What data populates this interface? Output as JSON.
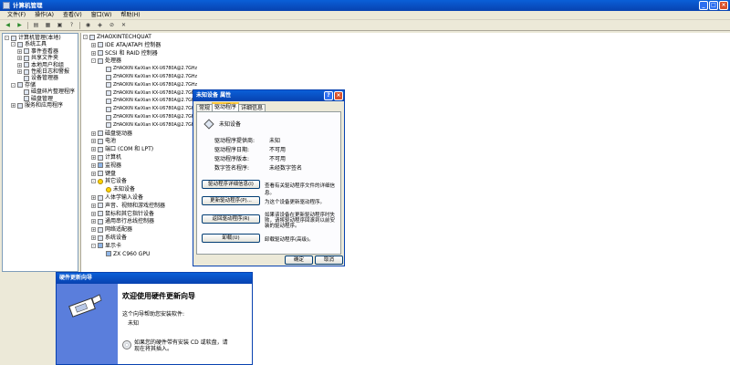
{
  "window": {
    "title": "计算机管理",
    "buttons": [
      "_",
      "□",
      "×"
    ]
  },
  "menu": [
    "文件(F)",
    "操作(A)",
    "查看(V)",
    "窗口(W)",
    "帮助(H)"
  ],
  "left_tree": [
    {
      "label": "计算机管理(本地)",
      "indent": 0,
      "exp": "-"
    },
    {
      "label": "系统工具",
      "indent": 1,
      "exp": "-"
    },
    {
      "label": "事件查看器",
      "indent": 2,
      "exp": "+"
    },
    {
      "label": "共享文件夹",
      "indent": 2,
      "exp": "+"
    },
    {
      "label": "本地用户和组",
      "indent": 2,
      "exp": "+"
    },
    {
      "label": "性能日志和警报",
      "indent": 2,
      "exp": "+"
    },
    {
      "label": "设备管理器",
      "indent": 2,
      "exp": ""
    },
    {
      "label": "存储",
      "indent": 1,
      "exp": "-"
    },
    {
      "label": "磁盘碎片整理程序",
      "indent": 2,
      "exp": ""
    },
    {
      "label": "磁盘管理",
      "indent": 2,
      "exp": ""
    },
    {
      "label": "服务和应用程序",
      "indent": 1,
      "exp": "+"
    }
  ],
  "device_tree": [
    {
      "label": "ZHAOXINTECHQUAT",
      "indent": 0,
      "exp": "-",
      "icon": "computer"
    },
    {
      "label": "IDE ATA/ATAPI 控制器",
      "indent": 1,
      "exp": "+",
      "icon": "device"
    },
    {
      "label": "SCSI 和 RAID 控制器",
      "indent": 1,
      "exp": "+",
      "icon": "device"
    },
    {
      "label": "处理器",
      "indent": 1,
      "exp": "-",
      "icon": "device"
    },
    {
      "label": "ZHAOXIN KaiXian KX-U6780A@2.7GHz",
      "indent": 2,
      "exp": "",
      "icon": "cpu"
    },
    {
      "label": "ZHAOXIN KaiXian KX-U6780A@2.7GHz",
      "indent": 2,
      "exp": "",
      "icon": "cpu"
    },
    {
      "label": "ZHAOXIN KaiXian KX-U6780A@2.7GHz",
      "indent": 2,
      "exp": "",
      "icon": "cpu"
    },
    {
      "label": "ZHAOXIN KaiXian KX-U6780A@2.7GHz",
      "indent": 2,
      "exp": "",
      "icon": "cpu"
    },
    {
      "label": "ZHAOXIN KaiXian KX-U6780A@2.7GHz",
      "indent": 2,
      "exp": "",
      "icon": "cpu"
    },
    {
      "label": "ZHAOXIN KaiXian KX-U6780A@2.7GHz",
      "indent": 2,
      "exp": "",
      "icon": "cpu"
    },
    {
      "label": "ZHAOXIN KaiXian KX-U6780A@2.7GHz",
      "indent": 2,
      "exp": "",
      "icon": "cpu"
    },
    {
      "label": "ZHAOXIN KaiXian KX-U6780A@2.7GHz",
      "indent": 2,
      "exp": "",
      "icon": "cpu"
    },
    {
      "label": "磁盘驱动器",
      "indent": 1,
      "exp": "+",
      "icon": "device"
    },
    {
      "label": "电池",
      "indent": 1,
      "exp": "+",
      "icon": "device"
    },
    {
      "label": "端口 (COM 和 LPT)",
      "indent": 1,
      "exp": "+",
      "icon": "device"
    },
    {
      "label": "计算机",
      "indent": 1,
      "exp": "+",
      "icon": "device"
    },
    {
      "label": "监视器",
      "indent": 1,
      "exp": "+",
      "icon": "monitor"
    },
    {
      "label": "键盘",
      "indent": 1,
      "exp": "+",
      "icon": "device"
    },
    {
      "label": "其它设备",
      "indent": 1,
      "exp": "-",
      "icon": "warn"
    },
    {
      "label": "未知设备",
      "indent": 2,
      "exp": "",
      "icon": "warn"
    },
    {
      "label": "人体学输入设备",
      "indent": 1,
      "exp": "+",
      "icon": "device"
    },
    {
      "label": "声音、视频和游戏控制器",
      "indent": 1,
      "exp": "+",
      "icon": "device"
    },
    {
      "label": "鼠标和其它指针设备",
      "indent": 1,
      "exp": "+",
      "icon": "device"
    },
    {
      "label": "通用串行总线控制器",
      "indent": 1,
      "exp": "+",
      "icon": "device"
    },
    {
      "label": "网络适配器",
      "indent": 1,
      "exp": "+",
      "icon": "device"
    },
    {
      "label": "系统设备",
      "indent": 1,
      "exp": "+",
      "icon": "device"
    },
    {
      "label": "显示卡",
      "indent": 1,
      "exp": "-",
      "icon": "monitor"
    },
    {
      "label": "ZX C960 GPU",
      "indent": 2,
      "exp": "",
      "icon": "monitor"
    }
  ],
  "dialog": {
    "title": "未知设备 属性",
    "buttons": [
      "?",
      "×"
    ],
    "tabs": [
      "常规",
      "驱动程序",
      "详细信息"
    ],
    "device_name": "未知设备",
    "info": [
      {
        "label": "驱动程序提供商:",
        "value": "未知"
      },
      {
        "label": "驱动程序日期:",
        "value": "不可用"
      },
      {
        "label": "驱动程序版本:",
        "value": "不可用"
      },
      {
        "label": "数字签名程序:",
        "value": "未经数字签名"
      }
    ],
    "actions": [
      {
        "button": "驱动程序详细信息(I)",
        "desc": "查看有关驱动程序文件的详细信息。"
      },
      {
        "button": "更新驱动程序(P)...",
        "desc": "为这个设备更新驱动程序。"
      },
      {
        "button": "返回驱动程序(R)",
        "desc": "如果该设备在更新驱动程序时失败，请将驱动程序回滚到以前安装的驱动程序。"
      },
      {
        "button": "卸载(U)",
        "desc": "卸载驱动程序(高级)。"
      }
    ],
    "ok": "确定",
    "cancel": "取消"
  },
  "wizard": {
    "title": "硬件更新向导",
    "heading": "欢迎使用硬件更新向导",
    "line1": "这个向导帮助您安装软件:",
    "device": "未知",
    "cd_hint": "如果您的硬件带有安装 CD 或软盘，请现在将其插入。"
  }
}
